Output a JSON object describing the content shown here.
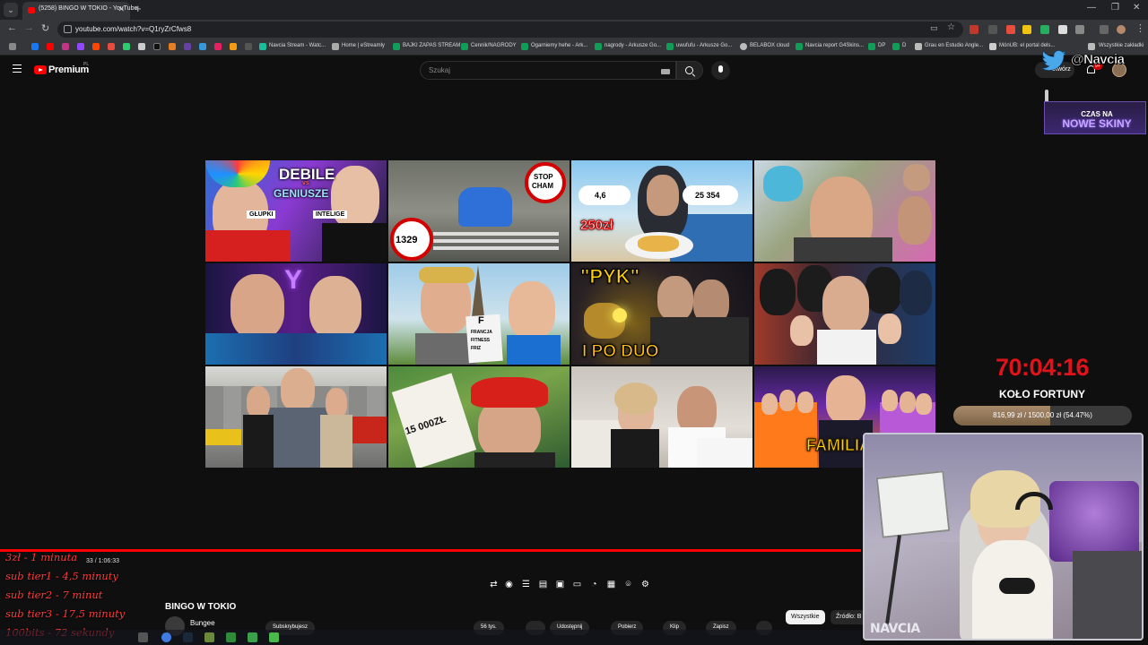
{
  "browser": {
    "tab_title": "(5258) BINGO W TOKIO - YouTube",
    "url": "youtube.com/watch?v=Q1ryZrCfws8",
    "bookmarks": [
      "Navcia Stream - Watc...",
      "Home | eStreamly",
      "BAJKI ZAPAS STREAM",
      "Cennik/NAGRODY",
      "Ogarniemy hehe - Ark...",
      "nagrody - Arkusze Go...",
      "uwufufu - Arkusze Go...",
      "BELABOX cloud",
      "Navcia report G4Skins...",
      "DP",
      "D",
      "Grau en Estudio Angle...",
      "MónUB: el portal dels...",
      "Wszystkie zakładki"
    ]
  },
  "youtube": {
    "brand": "Premium",
    "brand_region": "PL",
    "search_placeholder": "Szukaj",
    "create_label": "Utwórz",
    "notifications": "9+"
  },
  "thumbnails": [
    {
      "label_a": "DEBILE",
      "label_b": "vs",
      "label_c": "GENIUSZE",
      "label_d": "GŁUPKI",
      "label_e": "INTELIGE"
    },
    {
      "label_a": "STOP",
      "label_b": "CHAM",
      "label_c": "1329"
    },
    {
      "label_a": "4,6",
      "label_b": "25 354",
      "label_c": "250zł"
    },
    {},
    {
      "label_a": "Y"
    },
    {
      "label_a": "F",
      "label_b": "FRANCJA",
      "label_c": "FITNESS",
      "label_d": "FRIZ"
    },
    {
      "label_a": "\"PYK\"",
      "label_b": "I PO DUO"
    },
    {},
    {},
    {
      "label_a": "15 000ZŁ"
    },
    {},
    {
      "label_a": "FAMILIA"
    }
  ],
  "player": {
    "timecode": "33 / 1:06:33",
    "title": "BINGO W TOKIO",
    "channel": "Bungee",
    "subscribe": "Subskrybujesz",
    "like_count": "56 tys.",
    "share": "Udostępnij",
    "download": "Pobierz",
    "clip": "Klip",
    "save": "Zapisz",
    "chip_all": "Wszystkie",
    "chip_source": "Źródło: B"
  },
  "overlay": {
    "twitter_handle": "@Navcia",
    "skins_l1": "CZAS NA",
    "skins_l2": "NOWE SKINY",
    "timer": "70:04:16",
    "wheel_title": "KOŁO FORTUNY",
    "goal_text": "816,99 zł / 1500,00 zł (54.47%)",
    "goal_fraction": 0.5447,
    "cam_label": "NAVCIA",
    "info_lines": [
      "3zł - 1 minuta",
      "sub tier1 - 4,5 minuty",
      "sub tier2 - 7 minut",
      "sub tier3 - 17,5 minuty",
      "100bits - 72 sekundy"
    ]
  },
  "colors": {
    "accent": "#ff0000",
    "timer": "#e2121b",
    "info_text": "#ff3b3b",
    "background": "#0f0f0f"
  }
}
